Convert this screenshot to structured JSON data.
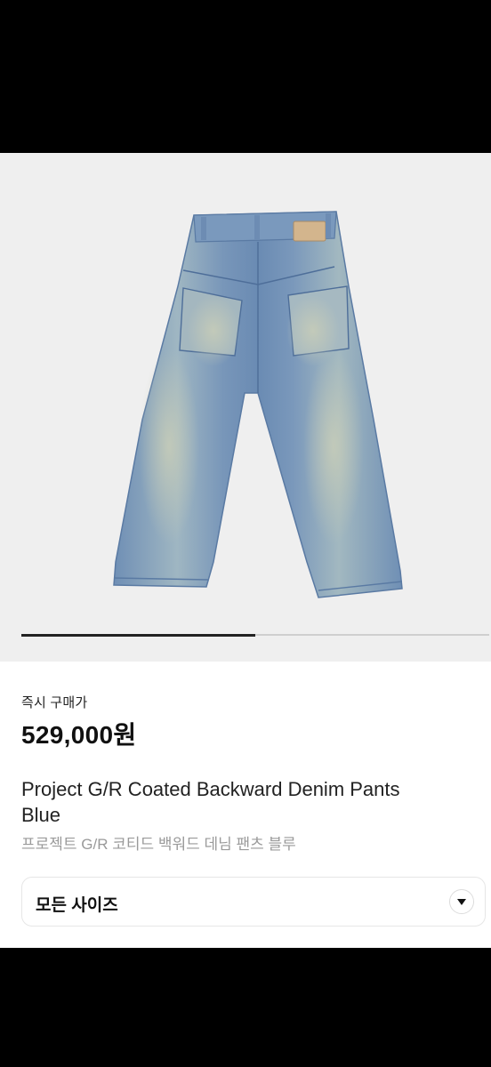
{
  "product": {
    "image_alt": "Project G/R Coated Backward Denim Pants Blue",
    "image_icon": "denim-pants-image",
    "gallery_progress": 0.5,
    "buy_label": "즉시 구매가",
    "price": "529,000원",
    "title_en": "Project G/R Coated Backward Denim Pants Blue",
    "title_ko": "프로젝트 G/R 코티드 백워드 데님 팬츠 블루"
  },
  "size_select": {
    "label": "모든 사이즈",
    "icon": "chevron-down-icon"
  },
  "colors": {
    "image_background": "#efefef",
    "denim": "#7f9ec0",
    "text_primary": "#111111",
    "text_secondary": "#9a9a9a"
  }
}
